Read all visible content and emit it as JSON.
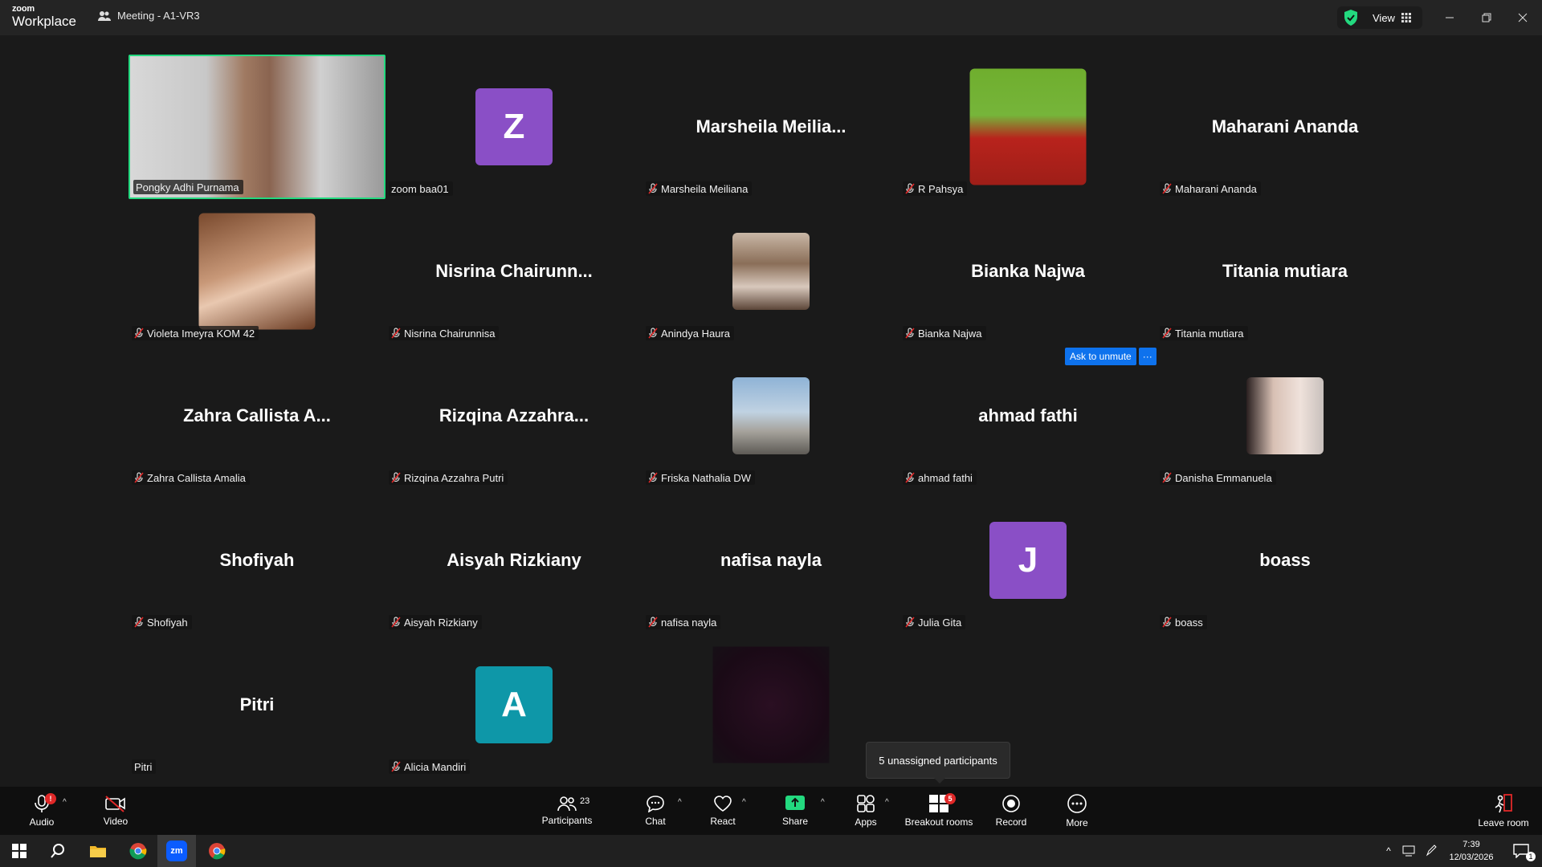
{
  "titlebar": {
    "logo_line1": "zoom",
    "logo_line2": "Workplace",
    "meeting_title": "Meeting - A1-VR3",
    "view_label": "View"
  },
  "tiles": [
    {
      "name": "Pongky Adhi Purnama",
      "type": "video",
      "muted": false,
      "active": true
    },
    {
      "name": "zoom baa01",
      "type": "avatar",
      "initial": "Z",
      "avatar_color": "#8a4fc6",
      "muted": false
    },
    {
      "name": "Marsheila Meiliana",
      "big_name": "Marsheila  Meilia...",
      "type": "name",
      "muted": true
    },
    {
      "name": "R Pahsya",
      "type": "photo",
      "muted": true
    },
    {
      "name": "Maharani Ananda",
      "big_name": "Maharani Ananda",
      "type": "name",
      "muted": true
    },
    {
      "name": "Violeta Imeyra KOM 42",
      "type": "photo",
      "muted": true
    },
    {
      "name": "Nisrina Chairunnisa",
      "big_name": "Nisrina  Chairunn...",
      "type": "name",
      "muted": true
    },
    {
      "name": "Anindya Haura",
      "type": "photo",
      "muted": true
    },
    {
      "name": "Bianka Najwa",
      "big_name": "Bianka Najwa",
      "type": "name",
      "muted": true
    },
    {
      "name": "Titania mutiara",
      "big_name": "Titania mutiara",
      "type": "name",
      "muted": true
    },
    {
      "name": "Zahra Callista Amalia",
      "big_name": "Zahra  Callista  A...",
      "type": "name",
      "muted": true
    },
    {
      "name": "Rizqina Azzahra Putri",
      "big_name": "Rizqina  Azzahra...",
      "type": "name",
      "muted": true
    },
    {
      "name": "Friska Nathalia DW",
      "type": "photo",
      "muted": true
    },
    {
      "name": "ahmad fathi",
      "big_name": "ahmad fathi",
      "type": "name",
      "muted": true
    },
    {
      "name": "Danisha Emmanuela",
      "type": "photo",
      "muted": true
    },
    {
      "name": "Shofiyah",
      "big_name": "Shofiyah",
      "type": "name",
      "muted": true
    },
    {
      "name": "Aisyah Rizkiany",
      "big_name": "Aisyah Rizkiany",
      "type": "name",
      "muted": true
    },
    {
      "name": "nafisa nayla",
      "big_name": "nafisa nayla",
      "type": "name",
      "muted": true
    },
    {
      "name": "Julia Gita",
      "type": "avatar",
      "initial": "J",
      "avatar_color": "#8a4fc6",
      "muted": true
    },
    {
      "name": "boass",
      "big_name": "boass",
      "type": "name",
      "muted": true
    },
    {
      "name": "Pitri",
      "big_name": "Pitri",
      "type": "name",
      "muted": false
    },
    {
      "name": "Alicia Mandiri",
      "type": "avatar",
      "initial": "A",
      "avatar_color": "#0e97a8",
      "muted": true
    },
    {
      "name": "",
      "type": "dark",
      "muted": false
    }
  ],
  "ask_unmute": {
    "label": "Ask to unmute",
    "more": "···"
  },
  "tooltip": "5 unassigned participants",
  "toolbar": {
    "audio": "Audio",
    "audio_badge": "!",
    "video": "Video",
    "participants": "Participants",
    "participants_count": "23",
    "chat": "Chat",
    "react": "React",
    "share": "Share",
    "apps": "Apps",
    "breakout": "Breakout rooms",
    "breakout_badge": "5",
    "record": "Record",
    "more": "More",
    "leave": "Leave room"
  },
  "taskbar": {
    "time": "7:39",
    "date": "12/03/2026",
    "notification_count": "1"
  },
  "colors": {
    "active_border": "#23d97f",
    "share_green": "#23d97f",
    "zoom_blue": "#0e72ed",
    "muted_red": "#e02828"
  }
}
